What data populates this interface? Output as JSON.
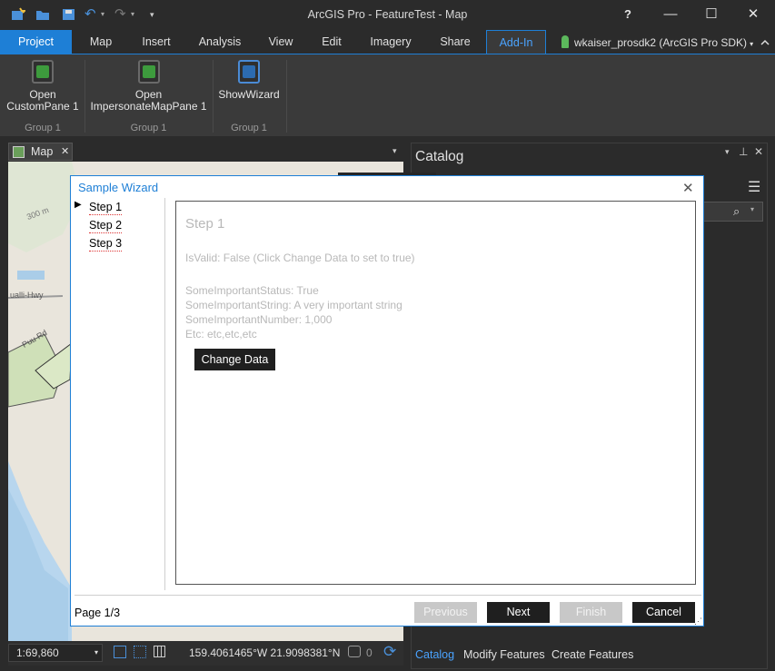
{
  "window": {
    "title": "ArcGIS Pro - FeatureTest - Map"
  },
  "ribbon_tabs": [
    "Project",
    "Map",
    "Insert",
    "Analysis",
    "View",
    "Edit",
    "Imagery",
    "Share",
    "Add-In"
  ],
  "user": "wkaiser_prosdk2 (ArcGIS Pro SDK)",
  "ribbon_buttons": [
    {
      "label_line1": "Open",
      "label_line2": "CustomPane 1"
    },
    {
      "label_line1": "Open",
      "label_line2": "ImpersonateMapPane 1"
    },
    {
      "label_line1": "ShowWizard",
      "label_line2": ""
    }
  ],
  "ribbon_groups": [
    "Group 1",
    "Group 1",
    "Group 1"
  ],
  "map_tab": {
    "label": "Map",
    "close": "✕"
  },
  "map_labels": {
    "elevation": "300 m",
    "road1": "ualli-Hwy",
    "road2": "Puu Rd"
  },
  "status_bar": {
    "scale": "1:69,860",
    "coordinates": "159.4061465°W 21.9098381°N",
    "selected_count": "0"
  },
  "catalog": {
    "title": "Catalog"
  },
  "catalog_bottom_tabs": [
    "Catalog",
    "Modify Features",
    "Create Features"
  ],
  "wizard": {
    "title": "Sample Wizard",
    "steps": [
      "Step 1",
      "Step 2",
      "Step 3"
    ],
    "current_step_marker": "▶",
    "content": {
      "heading": "Step 1",
      "is_valid": "IsValid: False (Click Change Data to set to true)",
      "status": "SomeImportantStatus: True",
      "string": "SomeImportantString: A very important string",
      "number": "SomeImportantNumber: 1,000",
      "etc": "Etc: etc,etc,etc",
      "change_button": "Change Data"
    },
    "page_indicator": "Page 1/3",
    "buttons": {
      "previous": "Previous",
      "next": "Next",
      "finish": "Finish",
      "cancel": "Cancel"
    }
  },
  "colors": {
    "accent": "#1e7fd6",
    "dark_bg": "#2b2b2b",
    "ribbon_bg": "#3a3a3a"
  }
}
